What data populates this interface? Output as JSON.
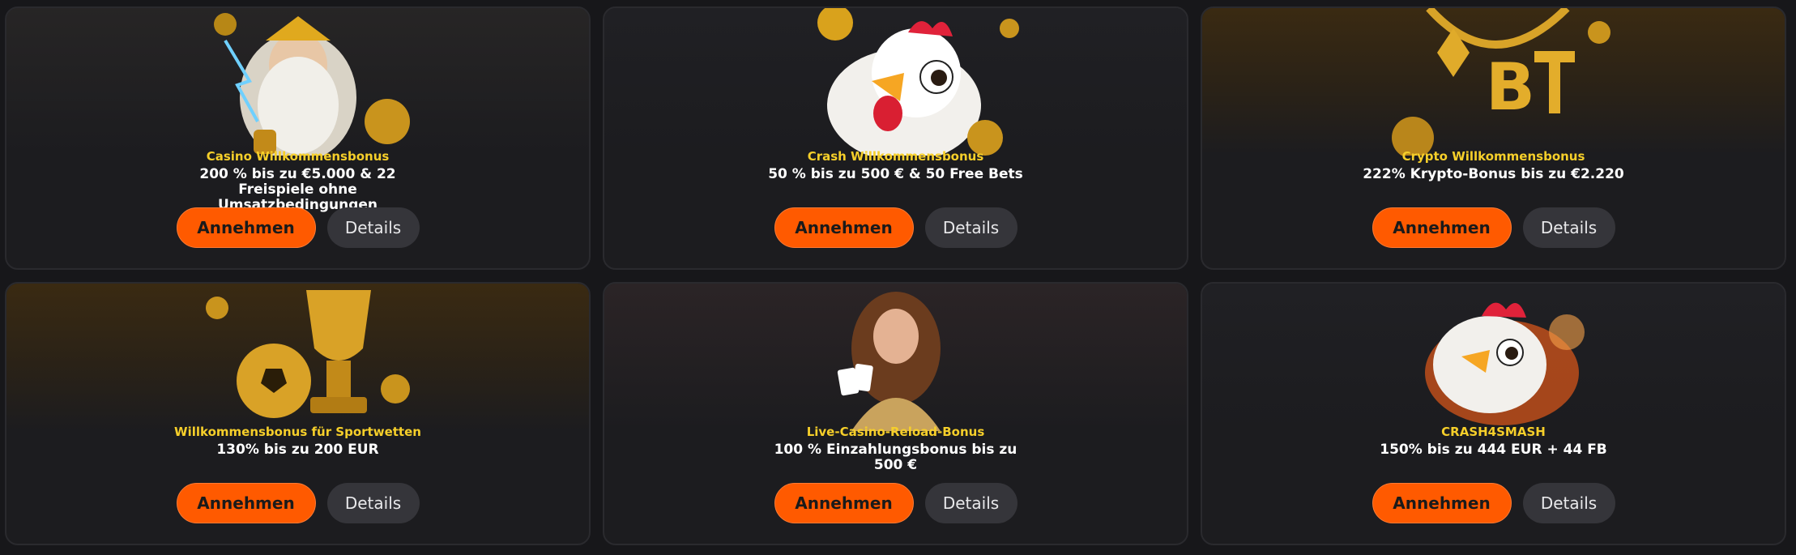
{
  "cards": [
    {
      "label": "Casino Willkommensbonus",
      "offer": "200 % bis zu €5.000 & 22 Freispiele ohne Umsatzbedingungen",
      "accept": "Annehmen",
      "details": "Details",
      "art": "zeus-illustration"
    },
    {
      "label": "Crash Willkommensbonus",
      "offer": "50 % bis zu 500 € & 50 Free Bets",
      "accept": "Annehmen",
      "details": "Details",
      "art": "chicken-illustration"
    },
    {
      "label": "Crypto Willkommensbonus",
      "offer": "222% Krypto-Bonus bis zu €2.220",
      "accept": "Annehmen",
      "details": "Details",
      "art": "crypto-chain-illustration"
    },
    {
      "label": "Willkommensbonus für Sportwetten",
      "offer": "130% bis zu 200 EUR",
      "accept": "Annehmen",
      "details": "Details",
      "art": "trophy-football-illustration"
    },
    {
      "label": "Live-Casino-Reload-Bonus",
      "offer": "100 % Einzahlungsbonus bis zu 500 €",
      "accept": "Annehmen",
      "details": "Details",
      "art": "croupier-illustration"
    },
    {
      "label": "CRASH4SMASH",
      "offer": "150% bis zu 444 EUR + 44 FB",
      "accept": "Annehmen",
      "details": "Details",
      "art": "fire-chicken-illustration"
    }
  ],
  "colors": {
    "accent": "#ff5a00",
    "label": "#f6cf2a",
    "background": "#17171a",
    "card": "#1c1c1f"
  }
}
